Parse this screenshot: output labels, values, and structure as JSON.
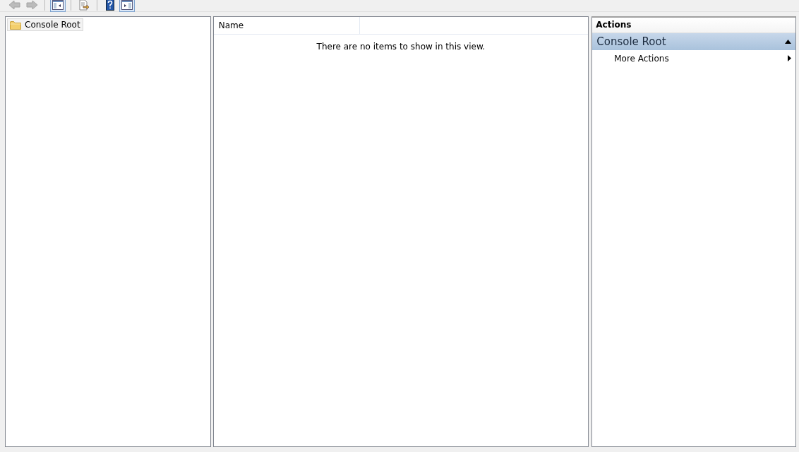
{
  "toolbar": [
    {
      "kind": "back",
      "disabled": true,
      "pressed": false
    },
    {
      "kind": "forward",
      "disabled": true,
      "pressed": false
    },
    {
      "kind": "separator"
    },
    {
      "kind": "tree-pane",
      "disabled": false,
      "pressed": true
    },
    {
      "kind": "separator"
    },
    {
      "kind": "export",
      "disabled": false,
      "pressed": false
    },
    {
      "kind": "separator"
    },
    {
      "kind": "help",
      "disabled": false,
      "pressed": false
    },
    {
      "kind": "action-pane",
      "disabled": false,
      "pressed": true
    }
  ],
  "tree": {
    "items": [
      {
        "label": "Console Root",
        "selected": true
      }
    ]
  },
  "list": {
    "columns": [
      "Name"
    ],
    "empty_message": "There are no items to show in this view."
  },
  "actions": {
    "title": "Actions",
    "sections": [
      {
        "title": "Console Root",
        "expanded": true,
        "items": [
          {
            "label": "More Actions"
          }
        ]
      }
    ]
  }
}
